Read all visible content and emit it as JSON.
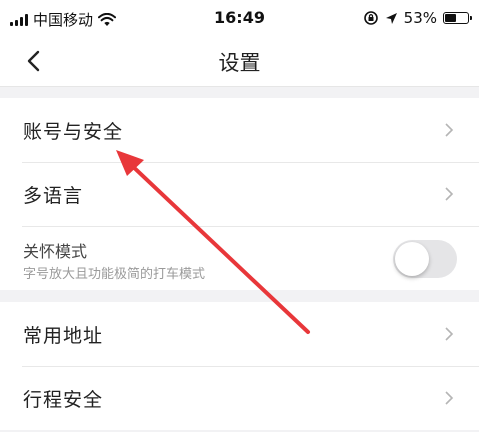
{
  "status_bar": {
    "carrier": "中国移动",
    "time": "16:49",
    "battery_percent_label": "53%",
    "battery_level": 0.53
  },
  "nav": {
    "title": "设置"
  },
  "settings": {
    "account_security": "账号与安全",
    "language": "多语言",
    "care_mode_title": "关怀模式",
    "care_mode_subtitle": "字号放大且功能极简的打车模式",
    "care_mode_on": false,
    "common_addresses": "常用地址",
    "trip_safety": "行程安全"
  },
  "colors": {
    "annotation_arrow": "#e8373a",
    "background": "#f2f2f4",
    "toggle_off": "#e5e5e7"
  }
}
